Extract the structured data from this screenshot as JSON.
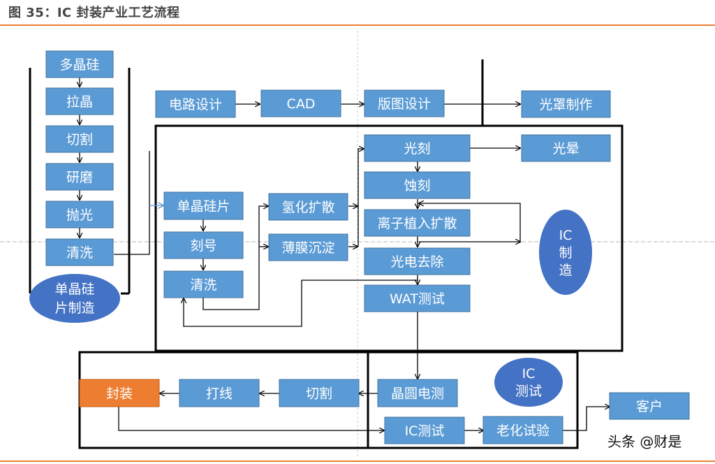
{
  "title": "图 35：IC 封装产业工艺流程",
  "watermark": "头条 @财是",
  "colors": {
    "node_fill": "#5b9bd5",
    "node_stroke": "#41719c",
    "ellipse_fill": "#4472c4",
    "highlight_fill": "#ed7d31",
    "accent_rule": "#ed7d31",
    "line": "#000000"
  },
  "groups": {
    "wafer_making": {
      "label_line1": "单晶硅",
      "label_line2": "片制造"
    },
    "ic_manufacturing": {
      "label_line1": "IC",
      "label_line2": "制",
      "label_line3": "造"
    },
    "ic_testing": {
      "label_line1": "IC",
      "label_line2": "测试"
    }
  },
  "nodes": {
    "polysilicon": "多晶硅",
    "crystal_pulling": "拉晶",
    "slicing": "切割",
    "grinding": "研磨",
    "polishing": "抛光",
    "cleaning_1": "清洗",
    "circuit_design": "电路设计",
    "cad": "CAD",
    "layout_design": "版图设计",
    "mask_making": "光罩制作",
    "single_wafer": "单晶硅片",
    "marking": "刻号",
    "cleaning_2": "清洗",
    "hydrogen_diffusion": "氢化扩散",
    "thin_film": "薄膜沉淀",
    "lithography": "光刻",
    "halation": "光晕",
    "etching": "蚀刻",
    "ion_implant": "离子植入扩散",
    "photoresist_removal": "光电去除",
    "wat_test": "WAT测试",
    "wafer_probe": "晶圆电测",
    "dicing": "切割",
    "wire_bonding": "打线",
    "packaging": "封装",
    "ic_test": "IC测试",
    "burn_in": "老化试验",
    "customer": "客户"
  }
}
